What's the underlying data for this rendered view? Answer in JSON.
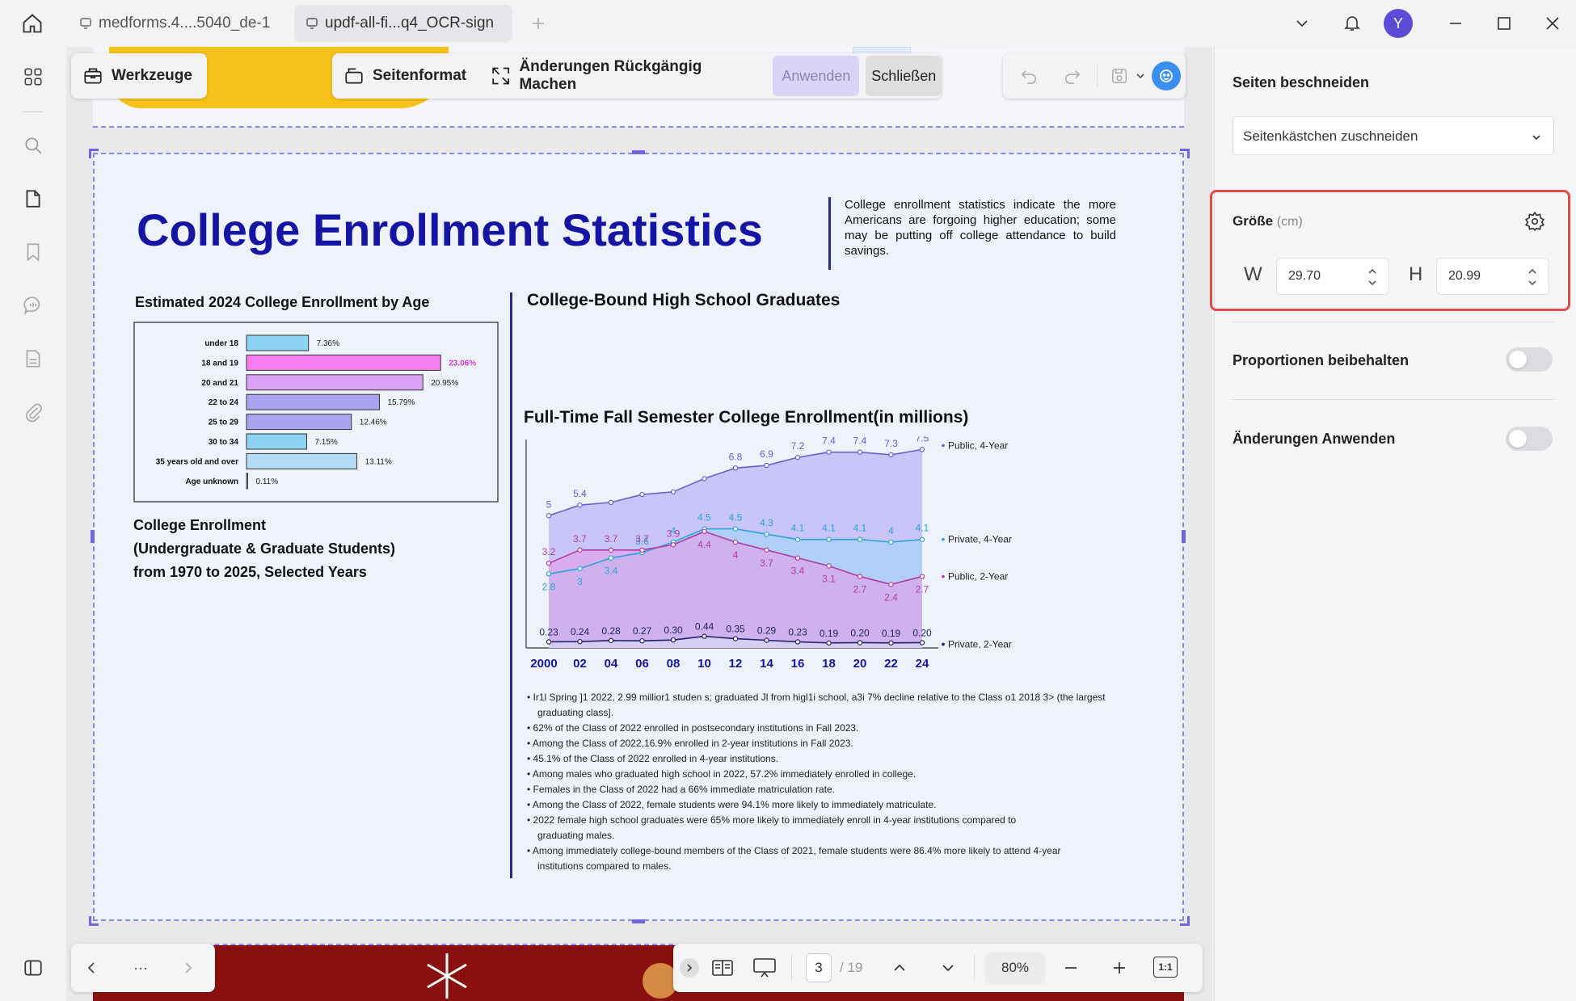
{
  "tabs": [
    {
      "label": "medforms.4....5040_de-1"
    },
    {
      "label": "updf-all-fi...q4_OCR-sign"
    }
  ],
  "user": {
    "avatar_letter": "Y"
  },
  "toolbar": {
    "tools_label": "Werkzeuge",
    "page_format_label": "Seitenformat",
    "undo_changes_label": "Änderungen Rückgängig Machen",
    "apply_label": "Anwenden",
    "close_label": "Schließen"
  },
  "document": {
    "title": "College Enrollment Statistics",
    "intro": "College enrollment statistics indicate the more Americans are forgoing higher education; some may be putting off college attendance to build savings.",
    "age_chart_title": "Estimated 2024 College Enrollment by Age",
    "enroll_heading_1": "College Enrollment",
    "enroll_heading_2": "(Undergraduate & Graduate Students)",
    "enroll_heading_3": "from 1970 to 2025, Selected Years",
    "graduates_heading": "College-Bound High School Graduates",
    "fulltime_title": "Full-Time Fall Semester College Enrollment(in millions)",
    "bullets": [
      "Ir1l Spring ]1 2022, 2.99 millior1 studen s; graduated Jl from higl1i school, a3i 7% decline relative to the Class o1 2018 3> (the largest",
      "graduating class].",
      "62% of the Class of 2022 enrolled in postsecondary institutions in Fall 2023.",
      "Among the Class of 2022,16.9% enrolled in 2-year institutions in Fall 2023.",
      "45.1% of the Class of 2022 enrolled in 4-year institutions.",
      "Among males who graduated high school in 2022, 57.2% immediately enrolled in college.",
      "Females in the Class of 2022 had a 66% immediate matriculation rate.",
      "Among the Class of 2022, female students were 94.1% more likely to immediately matriculate.",
      "2022 female high school graduates were 65% more likely to immediately enroll in 4-year institutions compared to",
      "graduating males.",
      "Among immediately college-bound members of the Class of 2021, female students were 86.4% more likely to attend 4-year",
      "institutions compared to males."
    ]
  },
  "chart_data": [
    {
      "type": "bar",
      "orientation": "horizontal",
      "title": "Estimated 2024 College Enrollment by Age",
      "categories": [
        "under 18",
        "18 and 19",
        "20 and 21",
        "22 to 24",
        "25 to 29",
        "30 to 34",
        "35 years old and over",
        "Age unknown"
      ],
      "values": [
        7.36,
        23.06,
        20.95,
        15.79,
        12.46,
        7.15,
        13.11,
        0.11
      ],
      "labels": [
        "7.36%",
        "23.06%",
        "20.95%",
        "15.79%",
        "12.46%",
        "7.15%",
        "13.11%",
        "0.11%"
      ],
      "colors": [
        "#8fd3f4",
        "#f77ef0",
        "#d9a0f4",
        "#a9a3f1",
        "#a9a3f1",
        "#8fd3f4",
        "#b3dcf8",
        "#b3dcf8"
      ],
      "xlim": [
        0,
        24
      ]
    },
    {
      "type": "area",
      "title": "Full-Time Fall Semester College Enrollment(in millions)",
      "categories": [
        "2000",
        "02",
        "04",
        "06",
        "08",
        "10",
        "12",
        "14",
        "16",
        "18",
        "20",
        "22",
        "24"
      ],
      "ylim": [
        0,
        8
      ],
      "series": [
        {
          "name": "Public, 4-Year",
          "color": "#6b5ed0",
          "values": [
            5,
            5.4,
            5.5,
            5.8,
            5.9,
            6.4,
            6.8,
            6.9,
            7.2,
            7.4,
            7.4,
            7.3,
            7.5
          ],
          "labels": [
            "5",
            "5.4",
            "",
            "",
            "",
            "",
            "6.8",
            "6.9",
            "7.2",
            "7.4",
            "7.4",
            "7.3",
            "7.5"
          ]
        },
        {
          "name": "Private, 4-Year",
          "color": "#2aa3d8",
          "values": [
            2.8,
            3,
            3.4,
            3.6,
            4,
            4.5,
            4.5,
            4.3,
            4.1,
            4.1,
            4.1,
            4,
            4.1
          ],
          "labels": [
            "2.8",
            "3",
            "3.4",
            "3.6",
            "4",
            "4.5",
            "4.5",
            "4.3",
            "4.1",
            "4.1",
            "4.1",
            "4",
            "4.1"
          ]
        },
        {
          "name": "Public, 2-Year",
          "color": "#b23aa6",
          "values": [
            3.2,
            3.7,
            3.7,
            3.7,
            3.9,
            4.4,
            4,
            3.7,
            3.4,
            3.1,
            2.7,
            2.4,
            2.7
          ],
          "labels": [
            "3.2",
            "3.7",
            "3.7",
            "3.7",
            "3.9",
            "4.4",
            "4",
            "3.7",
            "3.4",
            "3.1",
            "2.7",
            "2.4",
            "2.7"
          ]
        },
        {
          "name": "Private, 2-Year",
          "color": "#222266",
          "values": [
            0.23,
            0.24,
            0.28,
            0.27,
            0.3,
            0.44,
            0.35,
            0.29,
            0.23,
            0.19,
            0.2,
            0.19,
            0.2
          ],
          "labels": [
            "0.23",
            "0.24",
            "0.28",
            "0.27",
            "0.30",
            "0.44",
            "0.35",
            "0.29",
            "0.23",
            "0.19",
            "0.20",
            "0.19",
            "0.20"
          ]
        }
      ]
    }
  ],
  "right_panel": {
    "title": "Seiten beschneiden",
    "crop_mode": "Seitenkästchen zuschneiden",
    "size_label": "Größe",
    "size_unit": "(cm)",
    "w_label": "W",
    "w_value": "29.70",
    "h_label": "H",
    "h_value": "20.99",
    "keep_ratio_label": "Proportionen beibehalten",
    "apply_changes_label": "Änderungen Anwenden"
  },
  "bottom": {
    "ellipsis": "···",
    "current_page": "3",
    "total_pages": "/ 19",
    "zoom": "80%",
    "fit_label": "1:1"
  }
}
